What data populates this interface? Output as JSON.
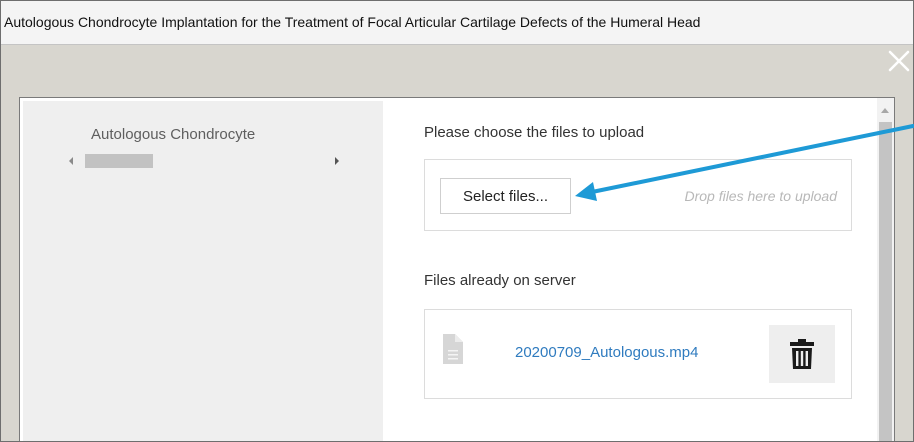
{
  "dialog": {
    "title": "Autologous Chondrocyte Implantation for the Treatment of Focal Articular Cartilage Defects of the Humeral Head"
  },
  "left_panel": {
    "title": "Autologous Chondrocyte"
  },
  "upload": {
    "label": "Please choose the files to upload",
    "select_button": "Select files...",
    "drop_hint": "Drop files here to upload"
  },
  "server_files": {
    "label": "Files already on server",
    "items": [
      {
        "filename": "20200709_Autologous.mp4"
      }
    ]
  },
  "icons": {
    "close": "close-icon",
    "file": "file-icon",
    "trash": "trash-icon"
  },
  "colors": {
    "link": "#2f7bbf",
    "annotation_arrow": "#1e9ad6",
    "titlebar_bg": "#f4f4f4",
    "frame_bg": "#d8d6cf"
  }
}
